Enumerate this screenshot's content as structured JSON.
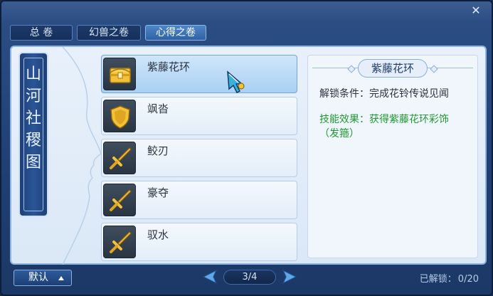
{
  "window": {
    "close_label": "✕"
  },
  "tabs": [
    {
      "label": "总 卷",
      "active": false
    },
    {
      "label": "幻兽之卷",
      "active": false
    },
    {
      "label": "心得之卷",
      "active": true
    }
  ],
  "scroll_banner": {
    "chars": [
      "山",
      "河",
      "社",
      "稷",
      "图"
    ]
  },
  "items": [
    {
      "name": "紫藤花环",
      "icon": "treasure-chest-icon",
      "selected": true
    },
    {
      "name": "飒沓",
      "icon": "shield-icon",
      "selected": false
    },
    {
      "name": "鲛刃",
      "icon": "sword-icon",
      "selected": false
    },
    {
      "name": "豪夺",
      "icon": "sword-icon",
      "selected": false
    },
    {
      "name": "驭水",
      "icon": "sword-icon",
      "selected": false
    }
  ],
  "detail": {
    "title": "紫藤花环",
    "unlock_label": "解锁条件：",
    "unlock_value": "完成花铃传说见闻",
    "effect_text": "技能效果：获得紫藤花环彩饰（发箍）"
  },
  "bottom": {
    "default_label": "默认",
    "page": "3/4",
    "unlocked_label": "已解锁：",
    "unlocked_value": "0/20"
  },
  "colors": {
    "effect": "#1f9a32",
    "accent": "#2f62a4"
  }
}
